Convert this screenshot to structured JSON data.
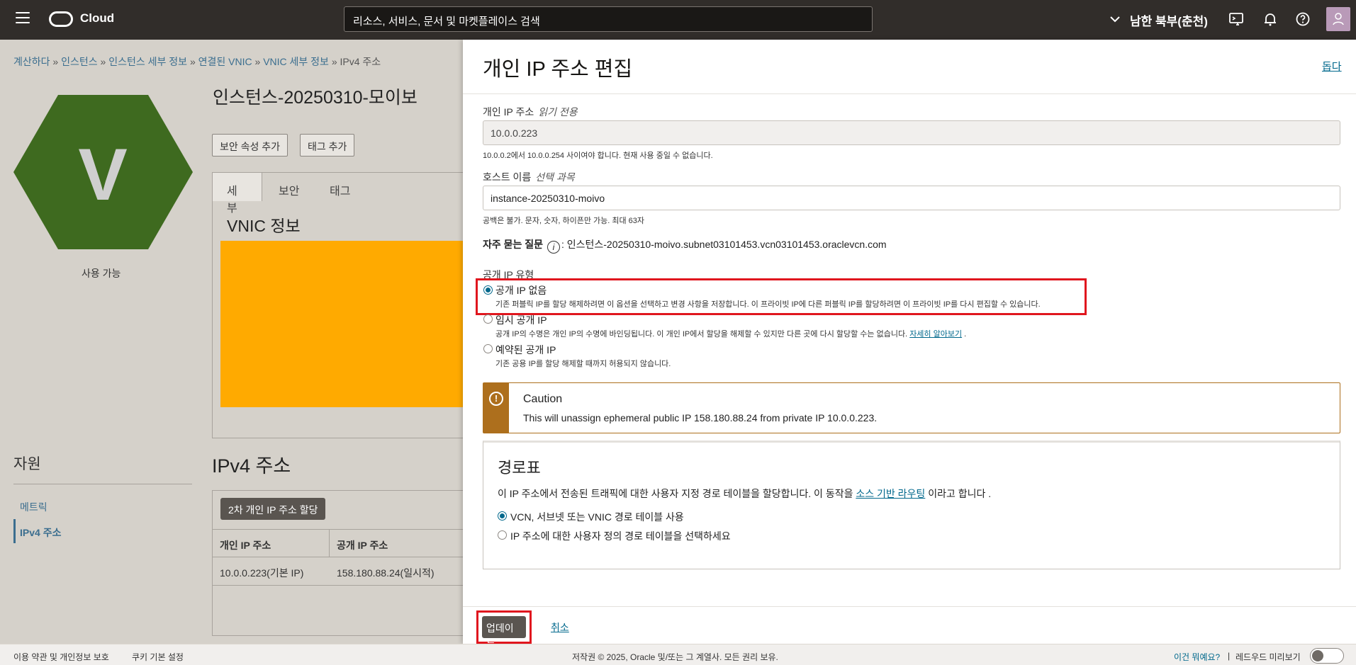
{
  "topbar": {
    "brand": "Cloud",
    "search_placeholder": "리소스, 서비스, 문서 및 마켓플레이스 검색",
    "region": "남한 북부(춘천)"
  },
  "breadcrumb": [
    {
      "label": "계산하다",
      "sep": "»"
    },
    {
      "label": "인스턴스",
      "sep": "»"
    },
    {
      "label": "인스턴스 세부 정보",
      "sep": "»"
    },
    {
      "label": "연결된 VNIC",
      "sep": "»"
    },
    {
      "label": "VNIC 세부 정보",
      "sep": "»"
    },
    {
      "label": "IPv4 주소",
      "sep": ""
    }
  ],
  "instance": {
    "letter": "V",
    "status": "사용 가능",
    "title": "인스턴스-20250310-모이보",
    "buttons": [
      "보안 속성 추가",
      "태그 추가"
    ],
    "tabs": [
      "세부",
      "보안",
      "태그"
    ],
    "vnic_title": "VNIC 정보"
  },
  "resources": {
    "title": "자원",
    "items": [
      "메트릭",
      "IPv4 주소"
    ]
  },
  "ipv4": {
    "title": "IPv4 주소",
    "assign_button": "2차 개인 IP 주소 할당",
    "columns": [
      "개인 IP 주소",
      "공개 IP 주소"
    ],
    "rows": [
      [
        "10.0.0.223(기본 IP)",
        "158.180.88.24(일시적)"
      ]
    ]
  },
  "panel": {
    "title": "개인 IP 주소 편집",
    "help": "돕다",
    "private_ip": {
      "label": "개인 IP 주소",
      "qualifier": "읽기 전용",
      "value": "10.0.0.223",
      "hint": "10.0.0.2에서 10.0.0.254 사이여야 합니다. 현재 사용 중일 수 없습니다."
    },
    "hostname": {
      "label": "호스트 이름",
      "qualifier": "선택 과목",
      "value": "instance-20250310-moivo",
      "hint": "공백은 불가. 문자, 숫자, 하이픈만 가능. 최대 63자"
    },
    "faq": {
      "label": "자주 묻는 질문",
      "info": "i",
      "value": ": 인스턴스-20250310-moivo.subnet03101453.vcn03101453.oraclevcn.com"
    },
    "public_ip": {
      "label": "공개 IP 유형",
      "options": [
        {
          "label": "공개 IP 없음",
          "desc": "기존 퍼블릭 IP를 할당 해제하려면 이 옵션을 선택하고 변경 사항을 저장합니다. 이 프라이빗 IP에 다른 퍼블릭 IP를 할당하려면 이 프라이빗 IP를 다시 편집할 수 있습니다.",
          "selected": true
        },
        {
          "label": "임시 공개 IP",
          "desc": "공개 IP의 수명은 개인 IP의 수명에 바인딩됩니다. 이 개인 IP에서 할당을 해제할 수 있지만 다른 곳에 다시 할당할 수는 없습니다.",
          "link": "자세히 알아보기",
          "desc_end": ".",
          "selected": false
        },
        {
          "label": "예약된 공개 IP",
          "desc": "기존 공용 IP를 할당 해제할 때까지 허용되지 않습니다.",
          "selected": false
        }
      ]
    },
    "caution": {
      "icon": "!",
      "title": "Caution",
      "text": "This will unassign ephemeral public IP 158.180.88.24 from private IP 10.0.0.223."
    },
    "route": {
      "title": "경로표",
      "text_before": "이 IP 주소에서 전송된 트래픽에 대한 사용자 지정 경로 테이블을 할당합니다. 이 동작을",
      "link": "소스 기반 라우팅",
      "text_after": "이라고 합니다 .",
      "options": [
        {
          "label": "VCN, 서브넷 또는 VNIC 경로 테이블 사용",
          "selected": true
        },
        {
          "label": "IP 주소에 대한 사용자 정의 경로 테이블을 선택하세요",
          "selected": false
        }
      ]
    },
    "update_button": "업데이트",
    "cancel": "취소"
  },
  "footer": {
    "terms": "이용 약관 및 개인정보 보호",
    "cookies": "쿠키 기본 설정",
    "copyright": "저작권 © 2025, Oracle 및/또는 그 계열사. 모든 권리 보유.",
    "what_new": "이건 뭐예요?",
    "divider": "|",
    "redwood": "레드우드 미리보기"
  },
  "colors": {
    "topbar": "#312d2a",
    "link": "#00688c",
    "hexagon": "#3e6a1f",
    "redacted": "#ffaa00",
    "caution": "#ad6f1d",
    "highlight": "#e0161e"
  }
}
